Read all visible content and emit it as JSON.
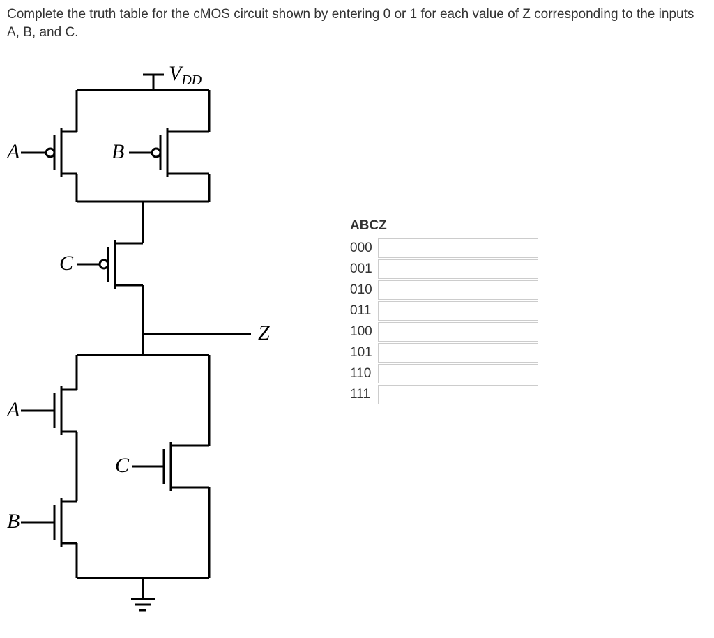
{
  "question": "Complete the truth table for the cMOS circuit shown by entering 0 or 1 for each value of Z corresponding to the inputs A, B, and C.",
  "circuit": {
    "supply_label": "V",
    "supply_sub": "DD",
    "output_label": "Z",
    "pmos_inputs": [
      "A",
      "B",
      "C"
    ],
    "nmos_inputs": [
      "A",
      "C",
      "B"
    ]
  },
  "table": {
    "header": "ABCZ",
    "rows": [
      {
        "abc": "000",
        "z": ""
      },
      {
        "abc": "001",
        "z": ""
      },
      {
        "abc": "010",
        "z": ""
      },
      {
        "abc": "011",
        "z": ""
      },
      {
        "abc": "100",
        "z": ""
      },
      {
        "abc": "101",
        "z": ""
      },
      {
        "abc": "110",
        "z": ""
      },
      {
        "abc": "111",
        "z": ""
      }
    ]
  }
}
